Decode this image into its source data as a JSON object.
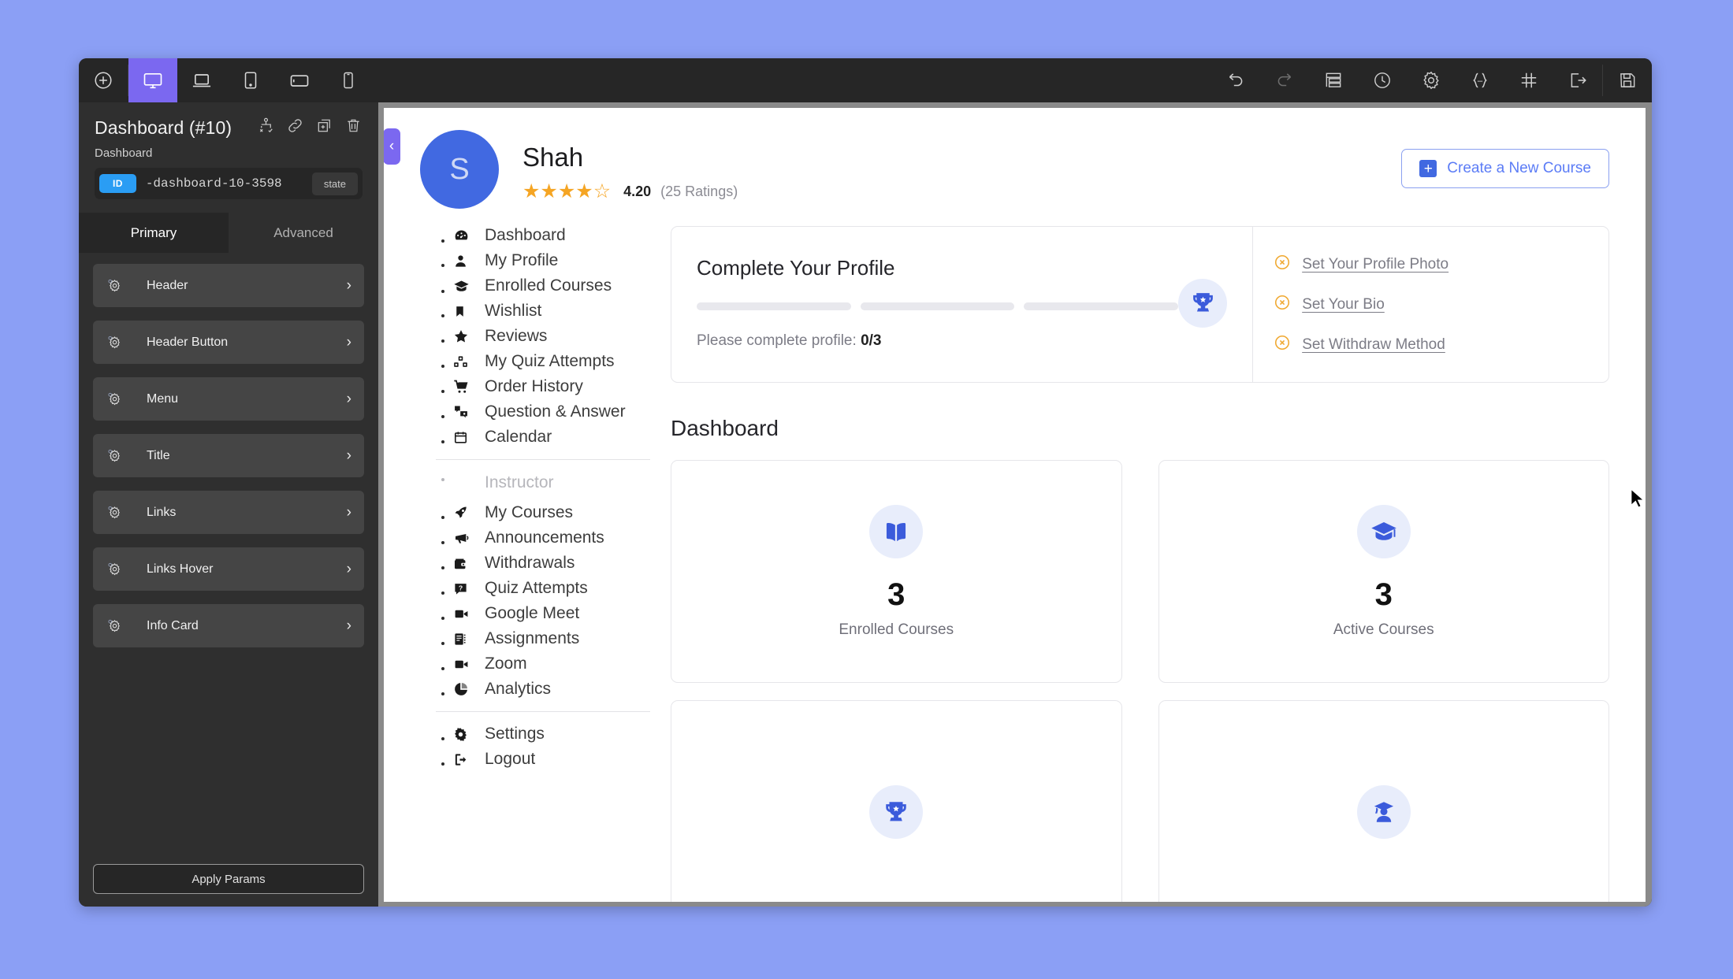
{
  "theme": {
    "desktop_bg": "#8b9ff5",
    "panel_bg": "#2f2f2f",
    "toolbar_bg": "#262626",
    "accent_purple": "#7b68f0",
    "accent_blue": "#4169e1",
    "star_orange": "#f5a524",
    "id_badge_blue": "#2a9df4"
  },
  "toolbar": {
    "left_icons": [
      {
        "name": "add-icon",
        "title": "Add"
      },
      {
        "name": "desktop-icon",
        "title": "Desktop",
        "active": true
      },
      {
        "name": "laptop-icon",
        "title": "Laptop"
      },
      {
        "name": "tablet-icon",
        "title": "Tablet"
      },
      {
        "name": "tablet-landscape-icon",
        "title": "Tablet Landscape"
      },
      {
        "name": "mobile-icon",
        "title": "Mobile"
      }
    ],
    "right_icons": [
      {
        "name": "undo-icon",
        "title": "Undo"
      },
      {
        "name": "redo-icon",
        "title": "Redo",
        "disabled": true
      },
      {
        "name": "layers-icon",
        "title": "Layers"
      },
      {
        "name": "history-icon",
        "title": "History"
      },
      {
        "name": "settings-gear-icon",
        "title": "Settings"
      },
      {
        "name": "code-braces-icon",
        "title": "Custom Code"
      },
      {
        "name": "grid-icon",
        "title": "Grid"
      },
      {
        "name": "export-icon",
        "title": "Export"
      },
      {
        "name": "save-icon",
        "title": "Save"
      }
    ]
  },
  "panel": {
    "title": "Dashboard (#10)",
    "subtitle": "Dashboard",
    "id_badge": "ID",
    "id_value": "-dashboard-10-3598",
    "state_badge": "state",
    "header_icons": [
      {
        "name": "structure-icon",
        "title": "Structure"
      },
      {
        "name": "link-icon",
        "title": "Link"
      },
      {
        "name": "duplicate-icon",
        "title": "Duplicate"
      },
      {
        "name": "trash-icon",
        "title": "Delete"
      }
    ],
    "tabs": [
      {
        "label": "Primary",
        "active": true
      },
      {
        "label": "Advanced",
        "active": false
      }
    ],
    "accordion_items": [
      {
        "label": "Header"
      },
      {
        "label": "Header Button"
      },
      {
        "label": "Menu"
      },
      {
        "label": "Title"
      },
      {
        "label": "Links"
      },
      {
        "label": "Links Hover"
      },
      {
        "label": "Info Card"
      }
    ],
    "apply_button": "Apply Params"
  },
  "preview": {
    "collapse_chevron": "‹",
    "profile": {
      "avatar_initial": "S",
      "name": "Shah",
      "stars_filled": 4,
      "stars_total": 5,
      "rating_value": "4.20",
      "rating_count": "(25 Ratings)"
    },
    "create_course_button": {
      "label": "Create a New Course",
      "icon": "plus-icon"
    },
    "nav": {
      "primary": [
        {
          "label": "Dashboard",
          "icon": "dashboard-icon"
        },
        {
          "label": "My Profile",
          "icon": "user-icon"
        },
        {
          "label": "Enrolled Courses",
          "icon": "graduation-cap-icon"
        },
        {
          "label": "Wishlist",
          "icon": "bookmark-icon"
        },
        {
          "label": "Reviews",
          "icon": "star-icon"
        },
        {
          "label": "My Quiz Attempts",
          "icon": "quiz-blocks-icon"
        },
        {
          "label": "Order History",
          "icon": "cart-icon"
        },
        {
          "label": "Question & Answer",
          "icon": "question-answer-icon"
        },
        {
          "label": "Calendar",
          "icon": "calendar-icon"
        }
      ],
      "section_label": "Instructor",
      "instructor": [
        {
          "label": "My Courses",
          "icon": "rocket-icon"
        },
        {
          "label": "Announcements",
          "icon": "megaphone-icon"
        },
        {
          "label": "Withdrawals",
          "icon": "wallet-icon"
        },
        {
          "label": "Quiz Attempts",
          "icon": "question-box-icon"
        },
        {
          "label": "Google Meet",
          "icon": "video-camera-icon"
        },
        {
          "label": "Assignments",
          "icon": "assignment-icon"
        },
        {
          "label": "Zoom",
          "icon": "video-camera-icon"
        },
        {
          "label": "Analytics",
          "icon": "pie-chart-icon"
        }
      ],
      "footer": [
        {
          "label": "Settings",
          "icon": "gear-icon"
        },
        {
          "label": "Logout",
          "icon": "logout-icon"
        }
      ]
    },
    "profile_card": {
      "title": "Complete Your Profile",
      "progress_segments": 3,
      "progress_filled": 0,
      "status_prefix": "Please complete profile: ",
      "status_value": "0/3",
      "trophy_icon": "trophy-icon",
      "todos": [
        {
          "label": "Set Your Profile Photo",
          "icon": "circle-x-icon"
        },
        {
          "label": "Set Your Bio",
          "icon": "circle-x-icon"
        },
        {
          "label": "Set Withdraw Method",
          "icon": "circle-x-icon"
        }
      ]
    },
    "dashboard_title": "Dashboard",
    "stats": [
      {
        "value": "3",
        "label": "Enrolled Courses",
        "icon": "book-icon"
      },
      {
        "value": "3",
        "label": "Active Courses",
        "icon": "graduation-cap-icon"
      },
      {
        "value": "",
        "label": "",
        "icon": "trophy-icon"
      },
      {
        "value": "",
        "label": "",
        "icon": "graduate-user-icon"
      }
    ]
  }
}
